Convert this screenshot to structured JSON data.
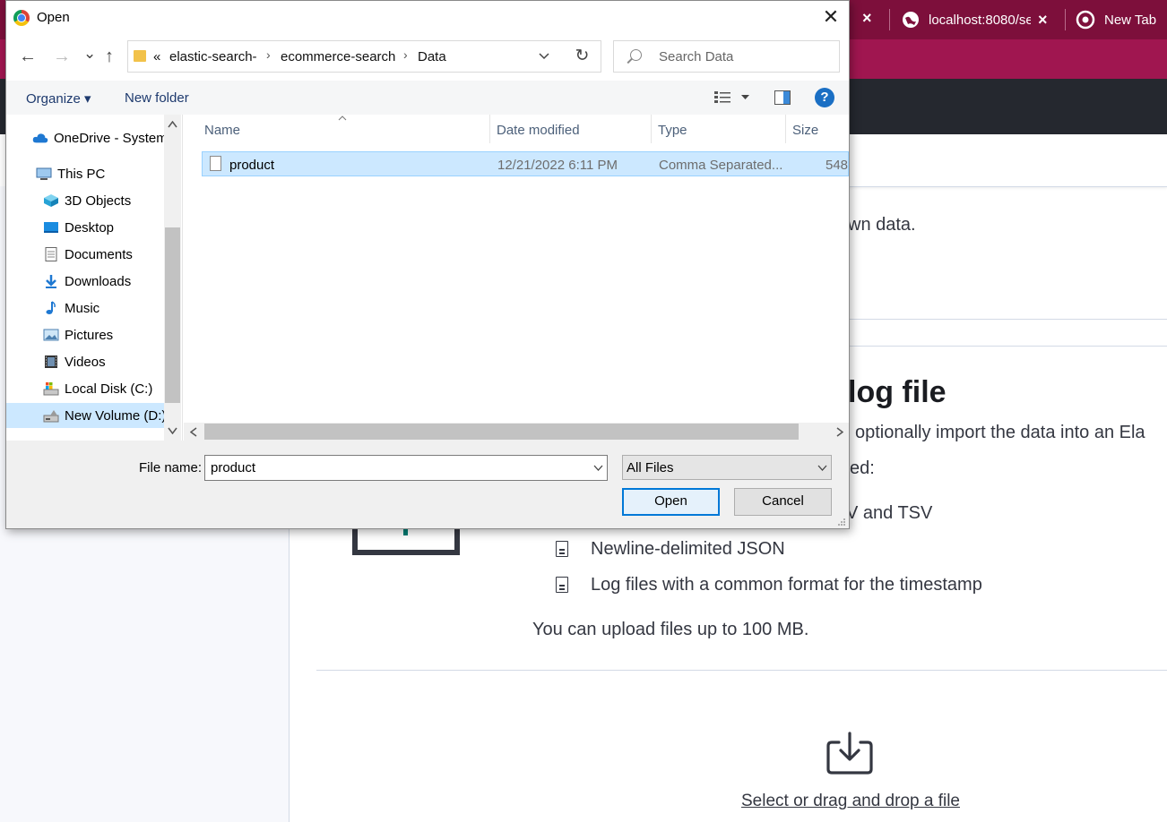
{
  "browser": {
    "tabs": [
      {
        "title": "localhost:8080/se"
      },
      {
        "title": "New Tab"
      }
    ],
    "partial_tab_close": "×",
    "tab_close": "×"
  },
  "page": {
    "line1": "wn data.",
    "section_title": "log file",
    "line2": "optionally import the data into an Ela",
    "line3": "ed:",
    "formats": [
      "V and TSV",
      "Newline-delimited JSON",
      "Log files with a common format for the timestamp"
    ],
    "upload_limit": "You can upload files up to 100 MB.",
    "upload_link": "Select or drag and drop a file"
  },
  "dialog": {
    "title": "Open",
    "close_label": "✕",
    "nav": {
      "back": "←",
      "forward": "→",
      "recent": "⌄",
      "up": "↑"
    },
    "breadcrumb": {
      "prefix": "«",
      "segments": [
        "elastic-search-",
        "ecommerce-search",
        "Data"
      ],
      "separator": "›"
    },
    "refresh": "↻",
    "search_placeholder": "Search Data",
    "toolbar": {
      "organize": "Organize ▾",
      "new_folder": "New folder",
      "help": "?"
    },
    "nav_pane": [
      {
        "label": "OneDrive - System",
        "icon": "cloud-icon"
      },
      {
        "label": "This PC",
        "icon": "computer-icon"
      },
      {
        "label": "3D Objects",
        "icon": "cube-icon"
      },
      {
        "label": "Desktop",
        "icon": "desktop-icon"
      },
      {
        "label": "Documents",
        "icon": "documents-icon"
      },
      {
        "label": "Downloads",
        "icon": "download-icon"
      },
      {
        "label": "Music",
        "icon": "music-icon"
      },
      {
        "label": "Pictures",
        "icon": "pictures-icon"
      },
      {
        "label": "Videos",
        "icon": "videos-icon"
      },
      {
        "label": "Local Disk (C:)",
        "icon": "drive-icon"
      },
      {
        "label": "New Volume (D:)",
        "icon": "drive-icon",
        "selected": true
      }
    ],
    "columns": {
      "name": "Name",
      "date": "Date modified",
      "type": "Type",
      "size": "Size"
    },
    "files": [
      {
        "name": "product",
        "date": "12/21/2022 6:11 PM",
        "type": "Comma Separated...",
        "size": "548"
      }
    ],
    "file_name_label": "File name:",
    "file_name_value": "product",
    "file_type": "All Files",
    "open_label": "Open",
    "cancel_label": "Cancel"
  }
}
